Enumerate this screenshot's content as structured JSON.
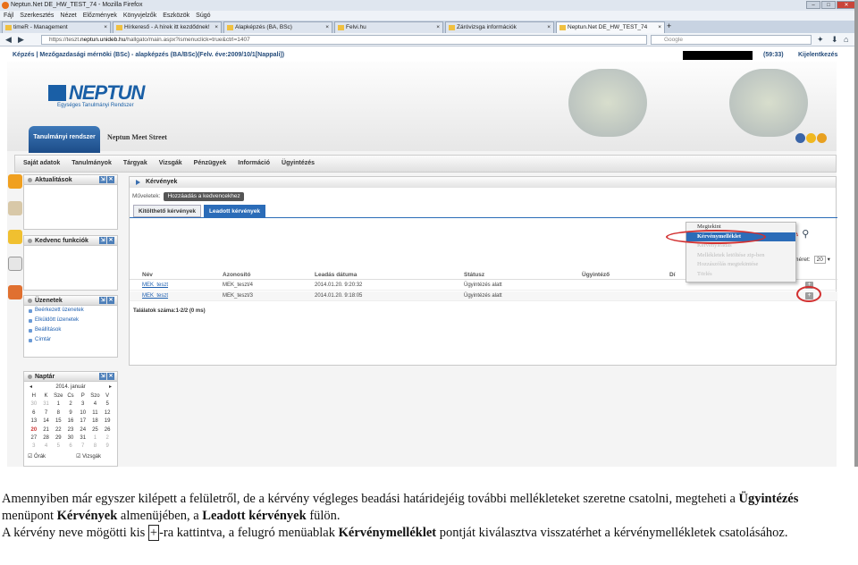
{
  "browser": {
    "title": "Neptun.Net DE_HW_TEST_74 - Mozilla Firefox",
    "menu": [
      "Fájl",
      "Szerkesztés",
      "Nézet",
      "Előzmények",
      "Könyvjelzők",
      "Eszközök",
      "Súgó"
    ],
    "tabs": [
      "timeR - Management",
      "Hírkereső - A hírek itt kezdődnek!",
      "Alapképzés (BA, BSc)",
      "Felvi.hu",
      "Záróvizsga információk",
      "Neptun.Net DE_HW_TEST_74"
    ],
    "url_prefix": "https://teszt.",
    "url_host": "neptun.unideb.hu",
    "url_path": "/hallgato/main.aspx?ismenuclick=true&ctrl=1407",
    "search_placeholder": "Google"
  },
  "neptun": {
    "top_line": "Képzés | Mezőgazdasági mérnöki (BSc) - alapképzés (BA/BSc)(Felv. éve:2009/10/1[Nappali])",
    "timer": "(59:33)",
    "logout": "Kijelentkezés",
    "logo": "NEPTUN",
    "logo_sub": "Egységes Tanulmányi Rendszer",
    "system_button": "Tanulmányi rendszer",
    "street": "Neptun Meet Street",
    "main_menu": [
      "Saját adatok",
      "Tanulmányok",
      "Tárgyak",
      "Vizsgák",
      "Pénzügyek",
      "Információ",
      "Ügyintézés"
    ]
  },
  "sidebar": {
    "news_title": "Aktualitások",
    "favorites_title": "Kedvenc funkciók",
    "messages_title": "Üzenetek",
    "messages_links": [
      "Beérkezett üzenetek",
      "Elküldött üzenetek",
      "Beállítások",
      "Címtár"
    ],
    "calendar_title": "Naptár",
    "calendar_month": "2014. január",
    "weekdays": [
      "H",
      "K",
      "Sze",
      "Cs",
      "P",
      "Szo",
      "V"
    ],
    "calendar_days": [
      [
        "30",
        "31",
        "1",
        "2",
        "3",
        "4",
        "5"
      ],
      [
        "6",
        "7",
        "8",
        "9",
        "10",
        "11",
        "12"
      ],
      [
        "13",
        "14",
        "15",
        "16",
        "17",
        "18",
        "19"
      ],
      [
        "20",
        "21",
        "22",
        "23",
        "24",
        "25",
        "26"
      ],
      [
        "27",
        "28",
        "29",
        "30",
        "31",
        "1",
        "2"
      ],
      [
        "3",
        "4",
        "5",
        "6",
        "7",
        "8",
        "9"
      ]
    ],
    "calendar_footer": [
      "Órák",
      "Vizsgák"
    ]
  },
  "content": {
    "title": "Kérvények",
    "operations_label": "Műveletek:",
    "operations_button": "Hozzáadás a kedvencekhez",
    "tabs": [
      "Kitölthető kérvények",
      "Leadott kérvények"
    ],
    "context_menu": [
      "Megtekint",
      "Kérvénymelléklet",
      "Kérvényleadás",
      "Mellékletek letöltése zip-ben",
      "Hozzászólás megtekintése",
      "Törlés"
    ],
    "page_size_label": "Oldalméret:",
    "page_size_value": "20",
    "columns": [
      "Név",
      "Azonosító",
      "Leadás dátuma",
      "Státusz",
      "Ügyintéző",
      "Dí"
    ],
    "rows": [
      {
        "name": "MEK_teszt",
        "id": "MEK_teszt/4",
        "date": "2014.01.20. 9:20:32",
        "status": "Ügyintézés alatt"
      },
      {
        "name": "MEK_teszt",
        "id": "MEK_teszt/3",
        "date": "2014.01.20. 9:18:05",
        "status": "Ügyintézés alatt"
      }
    ],
    "row_action": "+",
    "result_count": "Találatok száma:1-2/2 (0 ms)"
  },
  "caption": {
    "p1a": "Amennyiben már egyszer kilépett a felületről, de a kérvény végleges beadási határidejéig további mellékleteket szeretne csatolni, megteheti a ",
    "p1b": "Ügyintézés",
    "p1c": " menüpont ",
    "p1d": "Kérvények",
    "p1e": " almenüjében, a ",
    "p1f": "Leadott kérvények",
    "p1g": " fülön.",
    "p2a": "A kérvény neve mögötti kis ",
    "p2b": "+",
    "p2c": "-ra kattintva, a felugró menüablak ",
    "p2d": "Kérvénymelléklet",
    "p2e": " pontját kiválasztva visszatérhet a kérvénymellékletek csatolásához."
  }
}
